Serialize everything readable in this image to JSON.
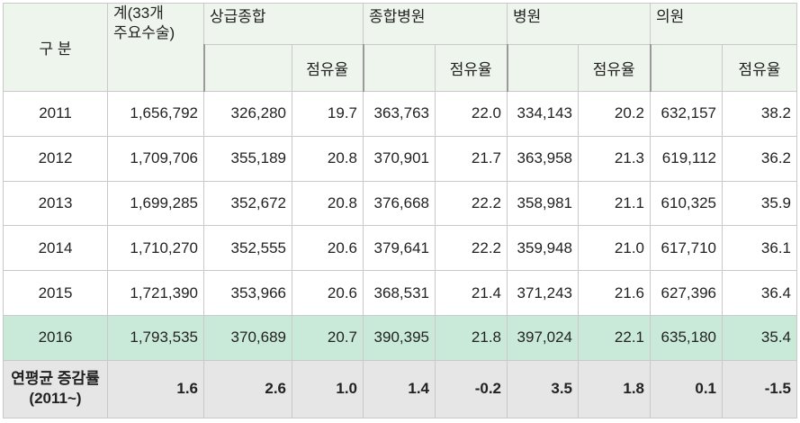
{
  "header": {
    "category": "구    분",
    "total_line1": "계(33개",
    "total_line2": "주요수술)",
    "groups": [
      "상급종합",
      "종합병원",
      "병원",
      "의원"
    ],
    "share_label": "점유율"
  },
  "rows": [
    {
      "year": "2011",
      "total": "1,656,792",
      "g1": "326,280",
      "s1": "19.7",
      "g2": "363,763",
      "s2": "22.0",
      "g3": "334,143",
      "s3": "20.2",
      "g4": "632,157",
      "s4": "38.2"
    },
    {
      "year": "2012",
      "total": "1,709,706",
      "g1": "355,189",
      "s1": "20.8",
      "g2": "370,901",
      "s2": "21.7",
      "g3": "363,958",
      "s3": "21.3",
      "g4": "619,112",
      "s4": "36.2"
    },
    {
      "year": "2013",
      "total": "1,699,285",
      "g1": "352,672",
      "s1": "20.8",
      "g2": "376,668",
      "s2": "22.2",
      "g3": "358,981",
      "s3": "21.1",
      "g4": "610,325",
      "s4": "35.9"
    },
    {
      "year": "2014",
      "total": "1,710,270",
      "g1": "352,555",
      "s1": "20.6",
      "g2": "379,641",
      "s2": "22.2",
      "g3": "359,948",
      "s3": "21.0",
      "g4": "617,710",
      "s4": "36.1"
    },
    {
      "year": "2015",
      "total": "1,721,390",
      "g1": "353,966",
      "s1": "20.6",
      "g2": "368,531",
      "s2": "21.4",
      "g3": "371,243",
      "s3": "21.6",
      "g4": "627,396",
      "s4": "36.4"
    },
    {
      "year": "2016",
      "total": "1,793,535",
      "g1": "370,689",
      "s1": "20.7",
      "g2": "390,395",
      "s2": "21.8",
      "g3": "397,024",
      "s3": "22.1",
      "g4": "635,180",
      "s4": "35.4"
    }
  ],
  "cagr": {
    "label_line1": "연평균 증감률",
    "label_line2": "(2011~)",
    "total": "1.6",
    "g1": "2.6",
    "s1": "1.0",
    "g2": "1.4",
    "s2": "-0.2",
    "g3": "3.5",
    "s3": "1.8",
    "g4": "0.1",
    "s4": "-1.5"
  },
  "colors": {
    "header_bg": "#eef5ec",
    "highlight_row": "#c9ead9",
    "summary_row": "#e6e6e6"
  }
}
